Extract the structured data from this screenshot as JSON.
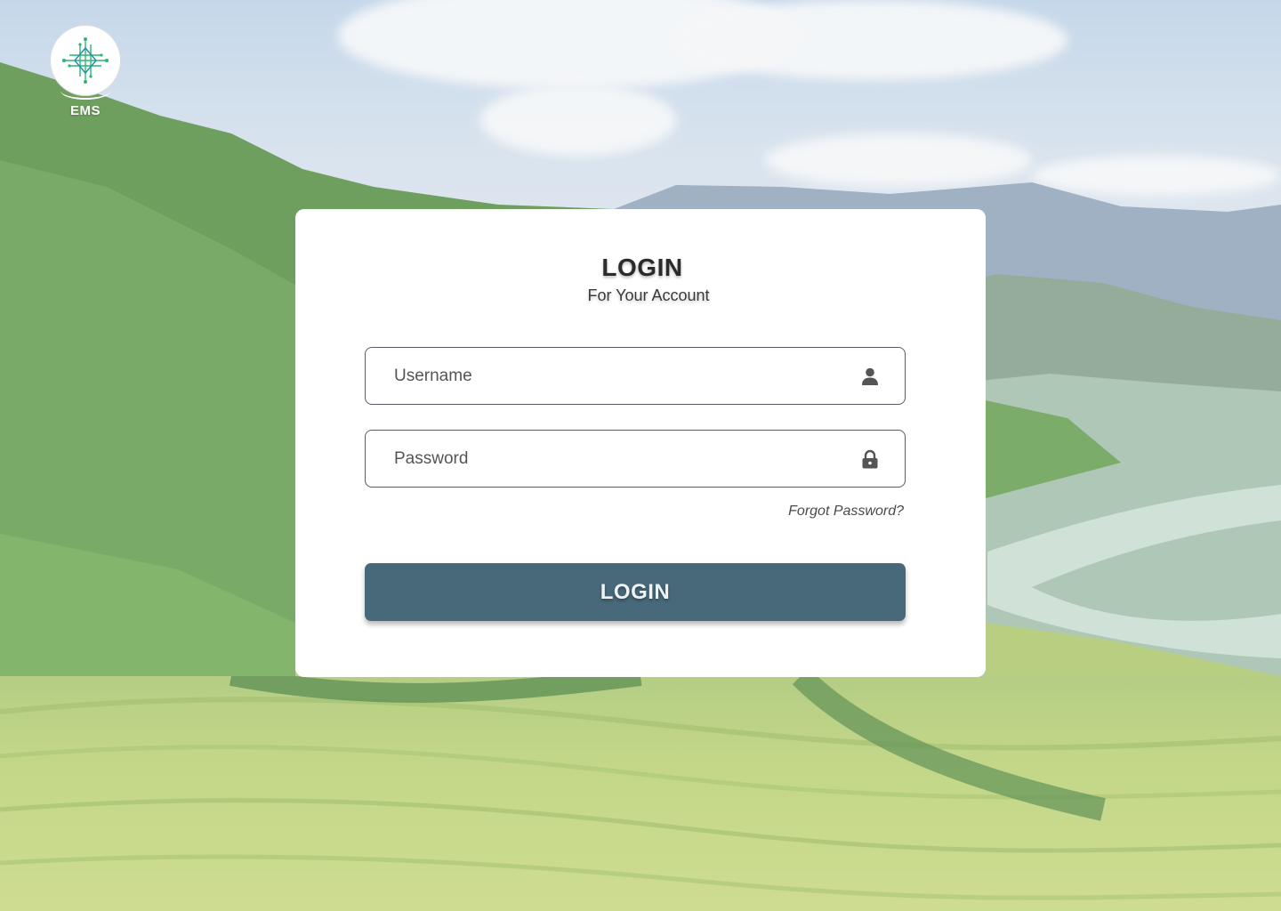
{
  "app": {
    "logo_text": "EMS"
  },
  "login": {
    "title": "LOGIN",
    "subtitle": "For Your Account",
    "username_placeholder": "Username",
    "password_placeholder": "Password",
    "forgot_password": "Forgot Password?",
    "button_label": "LOGIN"
  },
  "icons": {
    "logo": "network-circuit-icon",
    "username": "user-icon",
    "password": "lock-icon"
  },
  "colors": {
    "button": "#47697a",
    "card": "#ffffff",
    "logo_accent": "#2bb673"
  }
}
